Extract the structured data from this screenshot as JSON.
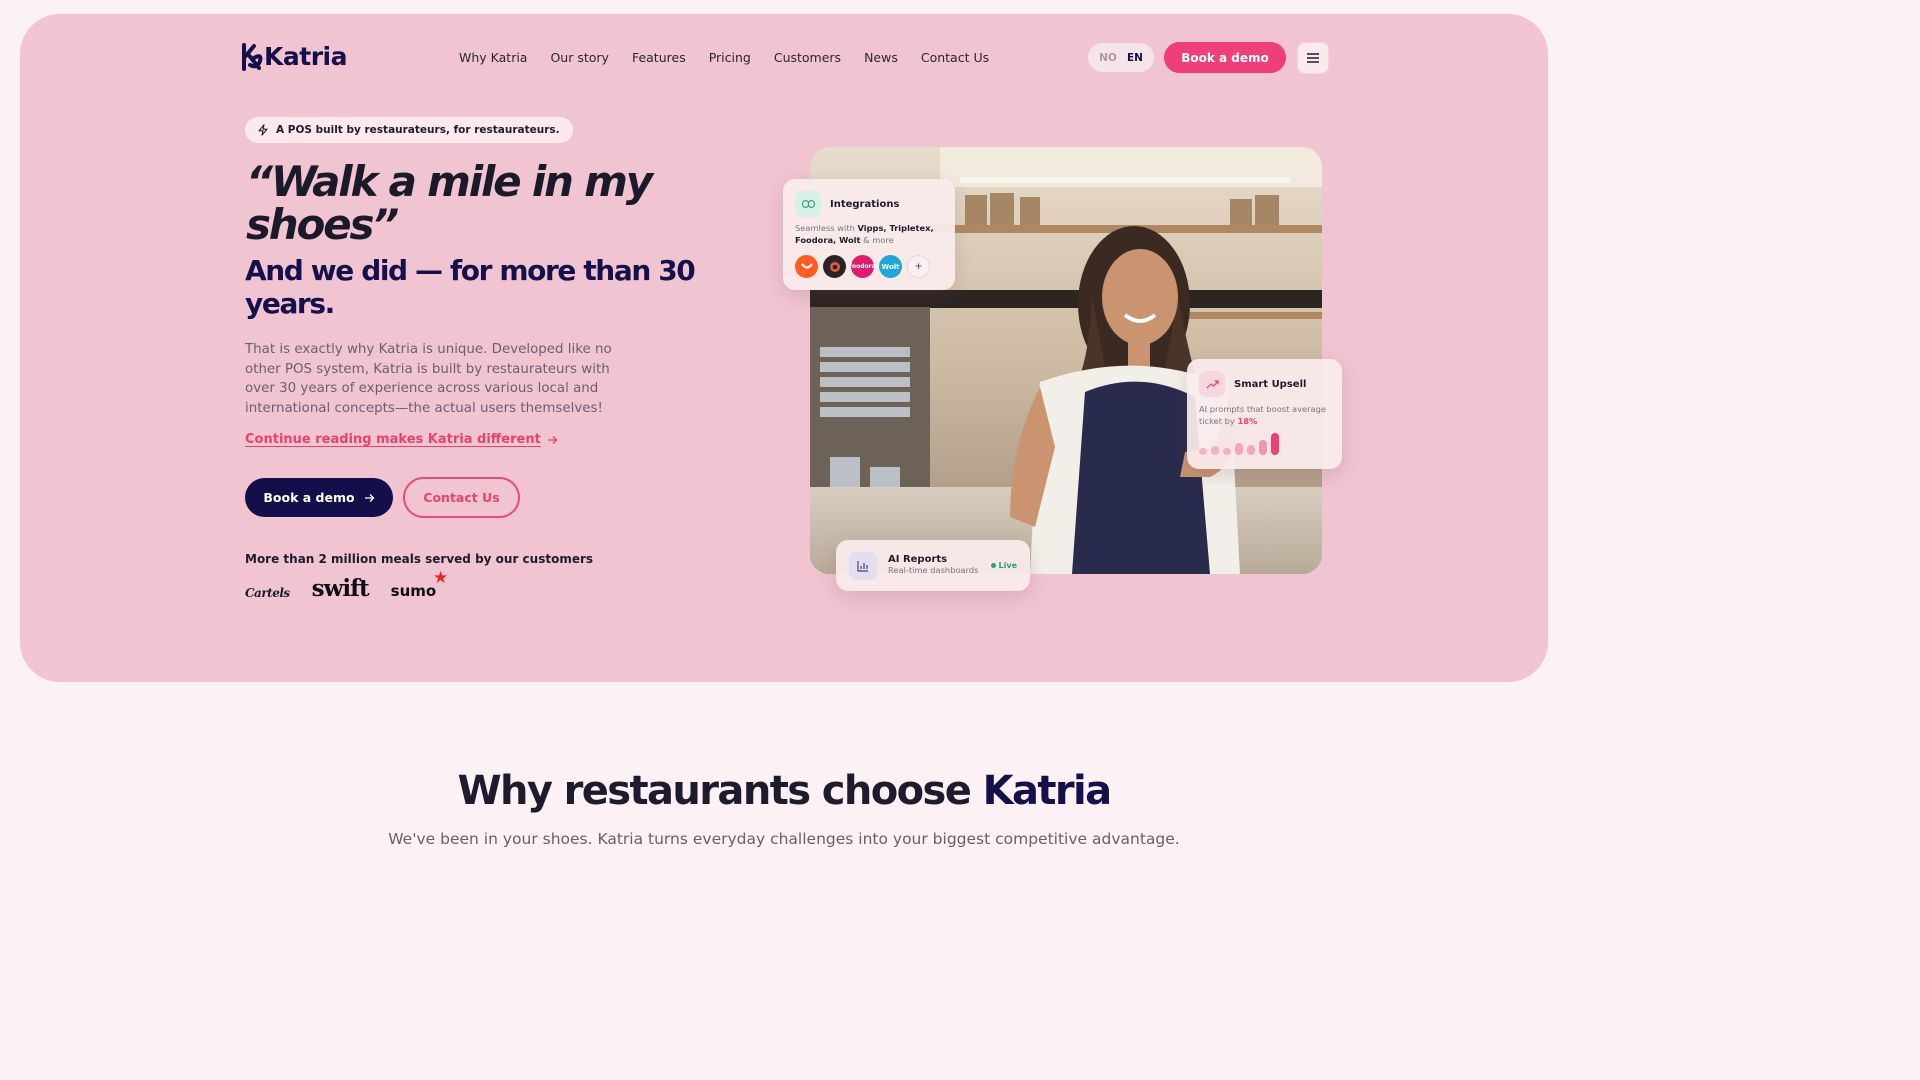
{
  "nav": {
    "logo_text": "Katria",
    "items": [
      "Why Katria",
      "Our story",
      "Features",
      "Pricing",
      "Customers",
      "News",
      "Contact Us"
    ],
    "lang_no": "NO",
    "lang_en": "EN",
    "cta": "Book a demo"
  },
  "hero": {
    "badge": "A POS built by restaurateurs, for restaurateurs.",
    "quote": "“Walk a mile in my shoes”",
    "subhead": "And we did — for more than 30 years.",
    "body": "That is exactly why Katria is unique. Developed like no other POS system, Katria is built by restaurateurs with over 30 years of experience across various local and international concepts—the actual users themselves!",
    "read_more": "Continue reading makes Katria different",
    "btn_demo": "Book a demo",
    "btn_contact": "Contact Us",
    "meals": "More than 2 million meals served by our customers",
    "brands": [
      "Cartels",
      "swift",
      "sumo"
    ]
  },
  "cards": {
    "integrations": {
      "title": "Integrations",
      "prefix": "Seamless with",
      "partners": "Vipps, Tripletex, Foodora, Wolt",
      "suffix": "& more",
      "partner_logos": [
        "foodora",
        "Wolt",
        "+"
      ]
    },
    "upsell": {
      "title": "Smart Upsell",
      "text": "AI prompts that boost average ticket by",
      "value": "18%"
    },
    "ai": {
      "title": "AI Reports",
      "sub": "Real-time dashboards",
      "status": "Live"
    }
  },
  "why": {
    "title_a": "Why restaurants choose",
    "title_b": "Katria",
    "sub": "We've been in your shoes. Katria turns everyday challenges into your biggest competitive advantage."
  },
  "colors": {
    "hero_bg": "#f1c4d1",
    "accent": "#ef3f79",
    "navy": "#140f4a"
  }
}
